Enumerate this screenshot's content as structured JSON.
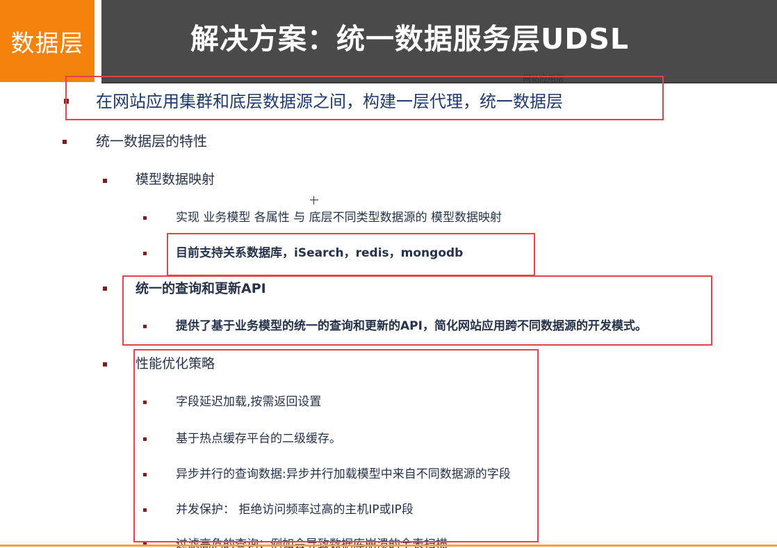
{
  "section_tab": "数据层",
  "title": "解决方案：统一数据服务层UDSL",
  "stray_label": "网站应用层",
  "bullets": {
    "b1": "在网站应用集群和底层数据源之间，构建一层代理，统一数据层",
    "b2": "统一数据层的特性",
    "b2_1": "模型数据映射",
    "b2_1_1": "实现 业务模型 各属性 与 底层不同类型数据源的 模型数据映射",
    "b2_1_2": "目前支持关系数据库，iSearch，redis，mongodb",
    "b2_2": "统一的查询和更新API",
    "b2_2_1": "提供了基于业务模型的统一的查询和更新的API，简化网站应用跨不同数据源的开发模式。",
    "b2_3": "性能优化策略",
    "b2_3_1": "字段延迟加载,按需返回设置",
    "b2_3_2": "基于热点缓存平台的二级缓存。",
    "b2_3_3": "异步并行的查询数据:异步并行加载模型中来自不同数据源的字段",
    "b2_3_4": "并发保护： 拒绝访问频率过高的主机IP或IP段",
    "b2_3_5": "过滤高危的查询：例如会导致数据库崩溃的全表扫描"
  },
  "colors": {
    "accent_orange": "#f5820a",
    "title_bar": "#4a4a4a",
    "highlight_red": "#e3434a",
    "bullet": "#7a1f1f"
  }
}
